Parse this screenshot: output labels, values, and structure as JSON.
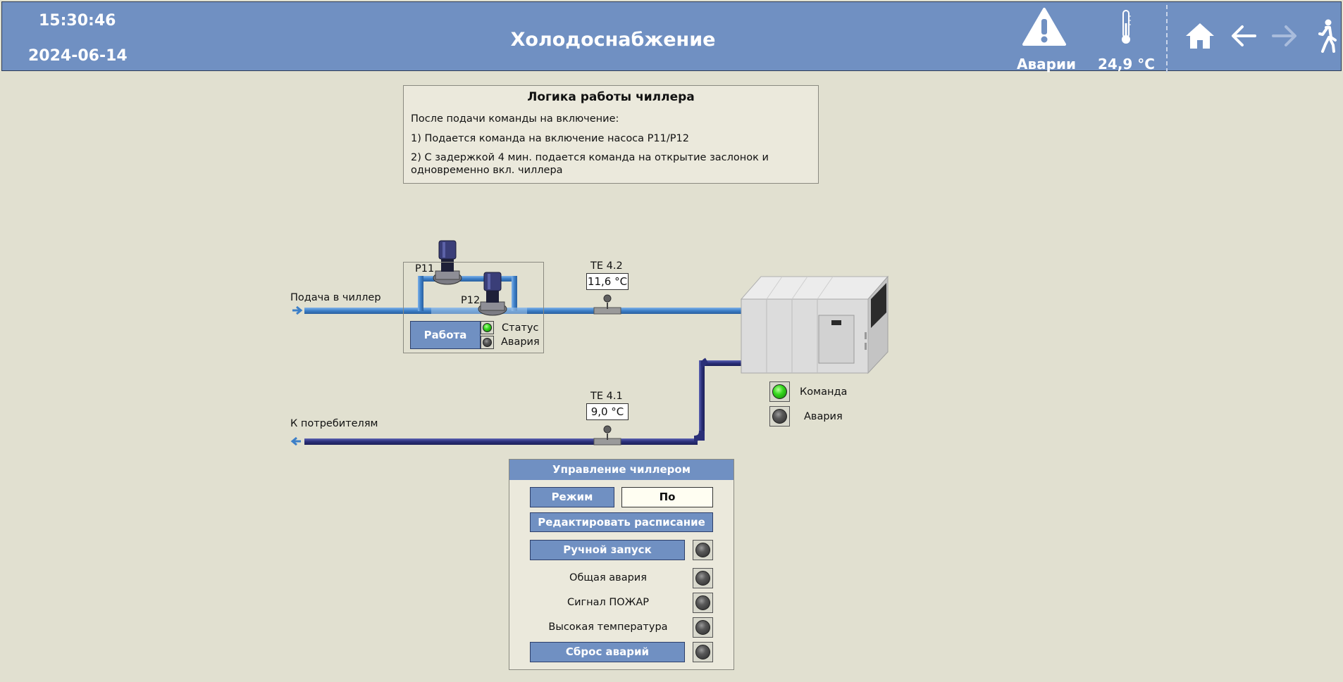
{
  "header": {
    "time": "15:30:46",
    "date": "2024-06-14",
    "title": "Холодоснабжение",
    "alarms_label": "Аварии",
    "outdoor_temp": "24,9 °C",
    "icons": [
      "warning-icon",
      "thermometer-icon",
      "home-icon",
      "back-arrow-icon",
      "forward-arrow-icon",
      "exit-icon"
    ]
  },
  "info": {
    "title": "Логика работы чиллера",
    "line1": "После подачи команды на включение:",
    "line2": "1) Подается команда на включение насоса P11/P12",
    "line3": "2) С задержкой 4 мин. подается команда на открытие заслонок и одновременно вкл. чиллера"
  },
  "scheme": {
    "supply_label": "Подача в чиллер",
    "return_label": "К потребителям",
    "pump1": "P11",
    "pump2": "P12",
    "pump_state_button": "Работа",
    "pump_status_label": "Статус",
    "pump_alarm_label": "Авария",
    "te42_label": "TE 4.2",
    "te42_value": "11,6 °C",
    "te41_label": "TE 4.1",
    "te41_value": "9,0 °C",
    "chiller_command_label": "Команда",
    "chiller_alarm_label": "Авария"
  },
  "control": {
    "title": "Управление чиллером",
    "mode_button": "Режим",
    "mode_value": "По расписанию",
    "edit_schedule_button": "Редактировать расписание",
    "manual_start_button": "Ручной запуск",
    "general_alarm_label": "Общая авария",
    "fire_signal_label": "Сигнал ПОЖАР",
    "high_temp_label": "Высокая температура",
    "reset_button": "Сброс аварий"
  },
  "colors": {
    "header_bg": "#7090c2",
    "background": "#e1e0d0",
    "supply_pipe": "#3c7fc8",
    "return_pipe": "#2a2f78",
    "lamp_on": "#36d81e",
    "lamp_off": "#3a3a3a"
  },
  "indicators": {
    "pump_status": "on",
    "pump_alarm": "off",
    "chiller_command": "on",
    "chiller_alarm": "off",
    "manual_start": "off",
    "general_alarm": "off",
    "fire_signal": "off",
    "high_temp": "off",
    "reset": "off"
  }
}
